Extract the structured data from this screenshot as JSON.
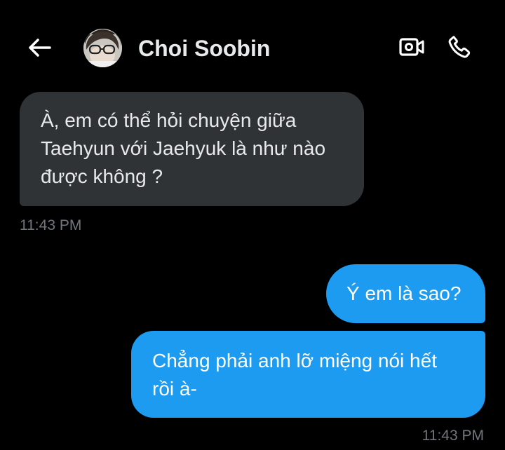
{
  "header": {
    "back_icon": "arrow-left-icon",
    "contact_name": "Choi Soobin",
    "video_icon": "video-camera-icon",
    "call_icon": "phone-icon"
  },
  "messages": [
    {
      "direction": "incoming",
      "lines": [
        "À, em có thể hỏi chuyện giữa",
        "Taehyun với Jaehyuk là như nào",
        "được không ?"
      ],
      "time": "11:43 PM"
    },
    {
      "direction": "outgoing",
      "lines": [
        "Ý em là sao?"
      ]
    },
    {
      "direction": "outgoing",
      "lines": [
        "Chẳng phải anh lỡ miệng nói hết",
        "rồi à-"
      ],
      "time": "11:43 PM"
    }
  ],
  "colors": {
    "background": "#000000",
    "incoming_bubble": "#2f3336",
    "outgoing_bubble": "#1d9bf0",
    "timestamp": "#71767b"
  }
}
